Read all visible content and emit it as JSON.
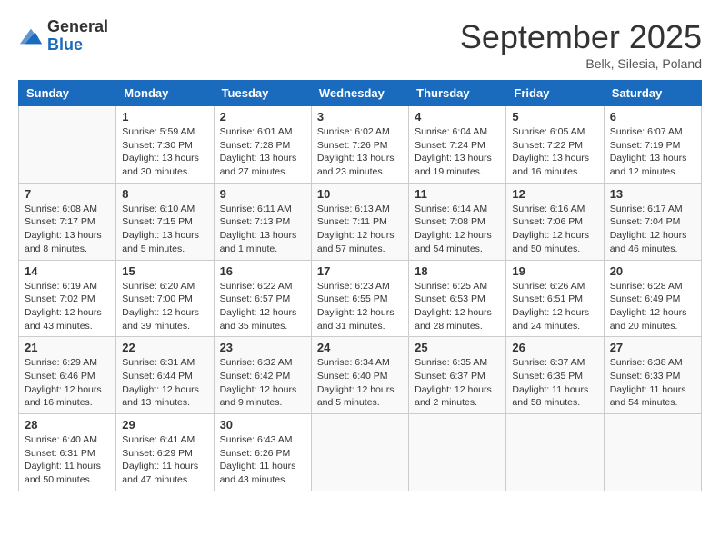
{
  "header": {
    "logo": {
      "general": "General",
      "blue": "Blue"
    },
    "title": "September 2025",
    "location": "Belk, Silesia, Poland"
  },
  "weekdays": [
    "Sunday",
    "Monday",
    "Tuesday",
    "Wednesday",
    "Thursday",
    "Friday",
    "Saturday"
  ],
  "weeks": [
    [
      {
        "day": "",
        "info": ""
      },
      {
        "day": "1",
        "info": "Sunrise: 5:59 AM\nSunset: 7:30 PM\nDaylight: 13 hours\nand 30 minutes."
      },
      {
        "day": "2",
        "info": "Sunrise: 6:01 AM\nSunset: 7:28 PM\nDaylight: 13 hours\nand 27 minutes."
      },
      {
        "day": "3",
        "info": "Sunrise: 6:02 AM\nSunset: 7:26 PM\nDaylight: 13 hours\nand 23 minutes."
      },
      {
        "day": "4",
        "info": "Sunrise: 6:04 AM\nSunset: 7:24 PM\nDaylight: 13 hours\nand 19 minutes."
      },
      {
        "day": "5",
        "info": "Sunrise: 6:05 AM\nSunset: 7:22 PM\nDaylight: 13 hours\nand 16 minutes."
      },
      {
        "day": "6",
        "info": "Sunrise: 6:07 AM\nSunset: 7:19 PM\nDaylight: 13 hours\nand 12 minutes."
      }
    ],
    [
      {
        "day": "7",
        "info": "Sunrise: 6:08 AM\nSunset: 7:17 PM\nDaylight: 13 hours\nand 8 minutes."
      },
      {
        "day": "8",
        "info": "Sunrise: 6:10 AM\nSunset: 7:15 PM\nDaylight: 13 hours\nand 5 minutes."
      },
      {
        "day": "9",
        "info": "Sunrise: 6:11 AM\nSunset: 7:13 PM\nDaylight: 13 hours\nand 1 minute."
      },
      {
        "day": "10",
        "info": "Sunrise: 6:13 AM\nSunset: 7:11 PM\nDaylight: 12 hours\nand 57 minutes."
      },
      {
        "day": "11",
        "info": "Sunrise: 6:14 AM\nSunset: 7:08 PM\nDaylight: 12 hours\nand 54 minutes."
      },
      {
        "day": "12",
        "info": "Sunrise: 6:16 AM\nSunset: 7:06 PM\nDaylight: 12 hours\nand 50 minutes."
      },
      {
        "day": "13",
        "info": "Sunrise: 6:17 AM\nSunset: 7:04 PM\nDaylight: 12 hours\nand 46 minutes."
      }
    ],
    [
      {
        "day": "14",
        "info": "Sunrise: 6:19 AM\nSunset: 7:02 PM\nDaylight: 12 hours\nand 43 minutes."
      },
      {
        "day": "15",
        "info": "Sunrise: 6:20 AM\nSunset: 7:00 PM\nDaylight: 12 hours\nand 39 minutes."
      },
      {
        "day": "16",
        "info": "Sunrise: 6:22 AM\nSunset: 6:57 PM\nDaylight: 12 hours\nand 35 minutes."
      },
      {
        "day": "17",
        "info": "Sunrise: 6:23 AM\nSunset: 6:55 PM\nDaylight: 12 hours\nand 31 minutes."
      },
      {
        "day": "18",
        "info": "Sunrise: 6:25 AM\nSunset: 6:53 PM\nDaylight: 12 hours\nand 28 minutes."
      },
      {
        "day": "19",
        "info": "Sunrise: 6:26 AM\nSunset: 6:51 PM\nDaylight: 12 hours\nand 24 minutes."
      },
      {
        "day": "20",
        "info": "Sunrise: 6:28 AM\nSunset: 6:49 PM\nDaylight: 12 hours\nand 20 minutes."
      }
    ],
    [
      {
        "day": "21",
        "info": "Sunrise: 6:29 AM\nSunset: 6:46 PM\nDaylight: 12 hours\nand 16 minutes."
      },
      {
        "day": "22",
        "info": "Sunrise: 6:31 AM\nSunset: 6:44 PM\nDaylight: 12 hours\nand 13 minutes."
      },
      {
        "day": "23",
        "info": "Sunrise: 6:32 AM\nSunset: 6:42 PM\nDaylight: 12 hours\nand 9 minutes."
      },
      {
        "day": "24",
        "info": "Sunrise: 6:34 AM\nSunset: 6:40 PM\nDaylight: 12 hours\nand 5 minutes."
      },
      {
        "day": "25",
        "info": "Sunrise: 6:35 AM\nSunset: 6:37 PM\nDaylight: 12 hours\nand 2 minutes."
      },
      {
        "day": "26",
        "info": "Sunrise: 6:37 AM\nSunset: 6:35 PM\nDaylight: 11 hours\nand 58 minutes."
      },
      {
        "day": "27",
        "info": "Sunrise: 6:38 AM\nSunset: 6:33 PM\nDaylight: 11 hours\nand 54 minutes."
      }
    ],
    [
      {
        "day": "28",
        "info": "Sunrise: 6:40 AM\nSunset: 6:31 PM\nDaylight: 11 hours\nand 50 minutes."
      },
      {
        "day": "29",
        "info": "Sunrise: 6:41 AM\nSunset: 6:29 PM\nDaylight: 11 hours\nand 47 minutes."
      },
      {
        "day": "30",
        "info": "Sunrise: 6:43 AM\nSunset: 6:26 PM\nDaylight: 11 hours\nand 43 minutes."
      },
      {
        "day": "",
        "info": ""
      },
      {
        "day": "",
        "info": ""
      },
      {
        "day": "",
        "info": ""
      },
      {
        "day": "",
        "info": ""
      }
    ]
  ]
}
